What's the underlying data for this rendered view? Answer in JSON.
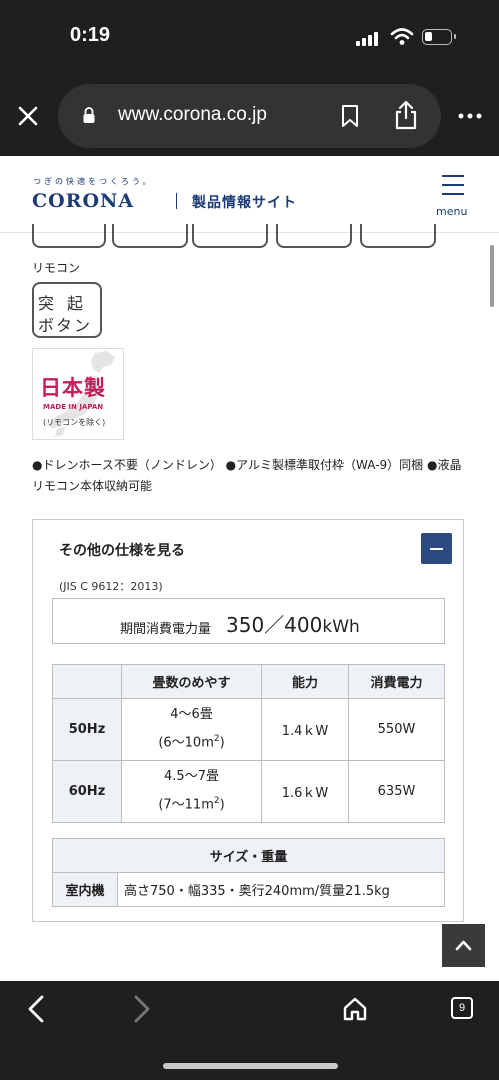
{
  "status_bar": {
    "time": "0:19"
  },
  "browser": {
    "url": "www.corona.co.jp",
    "tab_count": "9"
  },
  "site": {
    "tagline": "つぎの快適をつくろう。",
    "brand": "CORONA",
    "section": "製品情報サイト",
    "menu_label": "menu"
  },
  "remote": {
    "label": "リモコン",
    "badge_line1": "突起",
    "badge_line2": "ボタン"
  },
  "japan_badge": {
    "title": "日本製",
    "subtitle": "MADE IN JAPAN",
    "note": "(リモコンを除く)"
  },
  "features_text": "●ドレンホース不要（ノンドレン） ●アルミ製標準取付枠（WA-9）同梱 ●液晶リモコン本体収納可能",
  "spec": {
    "heading": "その他の仕様を見る",
    "standard": "(JIS C 9612：2013)",
    "energy_label": "期間消費電力量",
    "energy_value": "350／400",
    "energy_unit": "kWh",
    "table_headers": [
      "",
      "畳数のめやす",
      "能力",
      "消費電力"
    ],
    "rows": [
      {
        "freq": "50Hz",
        "tatami": "4〜6畳",
        "area_pre": "(6〜10m",
        "area_sup": "2",
        "area_post": ")",
        "capacity": "1.4ｋW",
        "power": "550W"
      },
      {
        "freq": "60Hz",
        "tatami": "4.5〜7畳",
        "area_pre": "(7〜11m",
        "area_sup": "2",
        "area_post": ")",
        "capacity": "1.6ｋW",
        "power": "635W"
      }
    ],
    "size_title": "サイズ・重量",
    "size_row_label": "室内機",
    "size_value": "高さ750・幅335・奥行240mm/質量21.5kg"
  },
  "colors": {
    "brand": "#1c3c77",
    "badge_pink": "#c41d5c",
    "table_header": "#eef1f5"
  }
}
